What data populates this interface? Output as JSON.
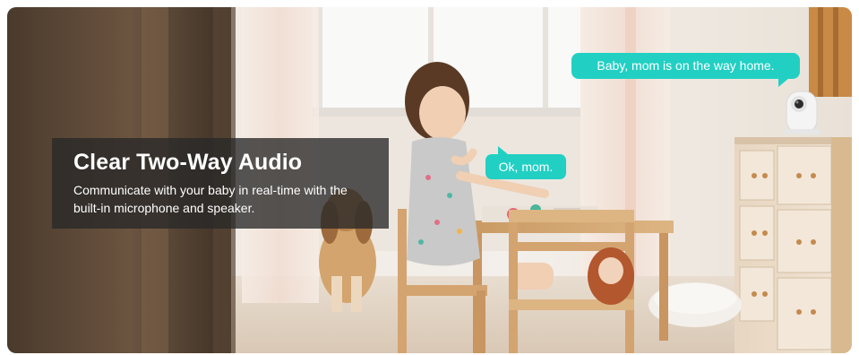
{
  "feature": {
    "title": "Clear Two-Way Audio",
    "description": "Communicate with your baby in real-time with the built-in microphone and speaker."
  },
  "bubbles": {
    "parent": "Baby, mom is on the way home.",
    "child": "Ok, mom."
  },
  "colors": {
    "bubble": "#21d0c3",
    "caption_overlay": "#282828"
  },
  "icons": {
    "camera": "baby-monitor-camera-icon"
  }
}
